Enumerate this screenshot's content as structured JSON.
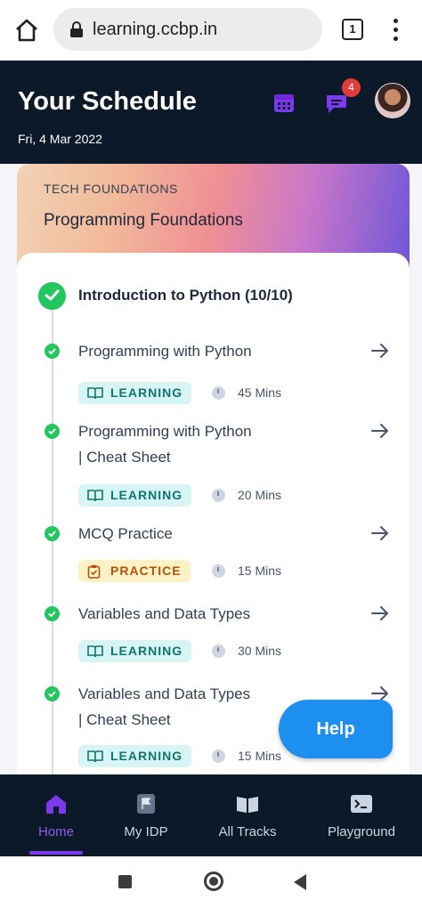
{
  "browser": {
    "url": "learning.ccbp.in",
    "tab_count": "1",
    "icons": [
      "home-icon",
      "lock-icon",
      "tabs-icon",
      "more-vert-icon"
    ]
  },
  "header": {
    "title": "Your Schedule",
    "date": "Fri, 4 Mar 2022",
    "notification_count": "4",
    "icons": [
      "calendar-icon",
      "chat-icon",
      "avatar"
    ]
  },
  "card": {
    "category": "TECH FOUNDATIONS",
    "course": "Programming Foundations",
    "section_title": "Introduction to Python (10/10)",
    "items": [
      {
        "name_line1": "Programming with Python",
        "name_line2": "",
        "tag": "LEARNING",
        "duration": "45 Mins"
      },
      {
        "name_line1": "Programming with Python",
        "name_line2": "| Cheat Sheet",
        "tag": "LEARNING",
        "duration": "20 Mins"
      },
      {
        "name_line1": "MCQ Practice",
        "name_line2": "",
        "tag": "PRACTICE",
        "duration": "15 Mins"
      },
      {
        "name_line1": "Variables and Data Types",
        "name_line2": "",
        "tag": "LEARNING",
        "duration": "30 Mins"
      },
      {
        "name_line1": "Variables and Data Types",
        "name_line2": "| Cheat Sheet",
        "tag": "LEARNING",
        "duration": "15 Mins"
      }
    ]
  },
  "help": {
    "label": "Help"
  },
  "bottom_nav": {
    "items": [
      {
        "label": "Home",
        "active": true
      },
      {
        "label": "My IDP",
        "active": false
      },
      {
        "label": "All Tracks",
        "active": false
      },
      {
        "label": "Playground",
        "active": false
      }
    ]
  },
  "colors": {
    "accent": "#7c3aed",
    "success": "#22c55e",
    "help": "#1d8ff0",
    "header_bg": "#0b1929"
  }
}
